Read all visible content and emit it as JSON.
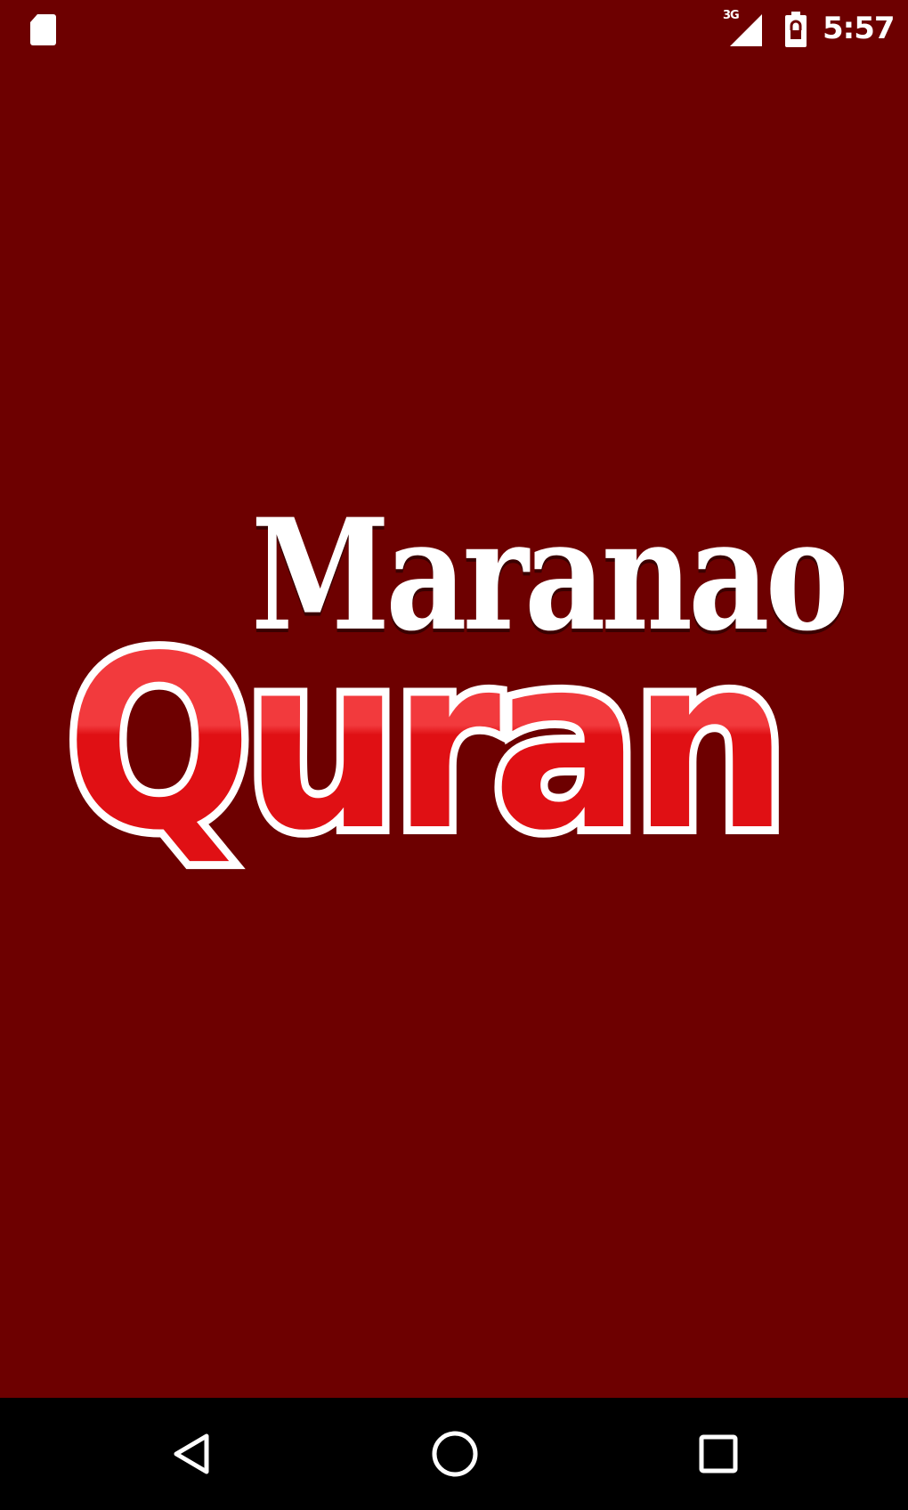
{
  "status_bar": {
    "network_label": "3G",
    "time": "5:57",
    "icons": [
      "sd-card-icon",
      "signal-icon",
      "battery-icon"
    ]
  },
  "logo": {
    "line1": "Maranao",
    "line2": "Quran"
  },
  "colors": {
    "background": "#6d0000",
    "logo_red": "#ee1a1d",
    "logo_white": "#ffffff",
    "nav_bar": "#000000"
  },
  "navigation": {
    "buttons": [
      "back-icon",
      "home-icon",
      "recents-icon"
    ]
  }
}
